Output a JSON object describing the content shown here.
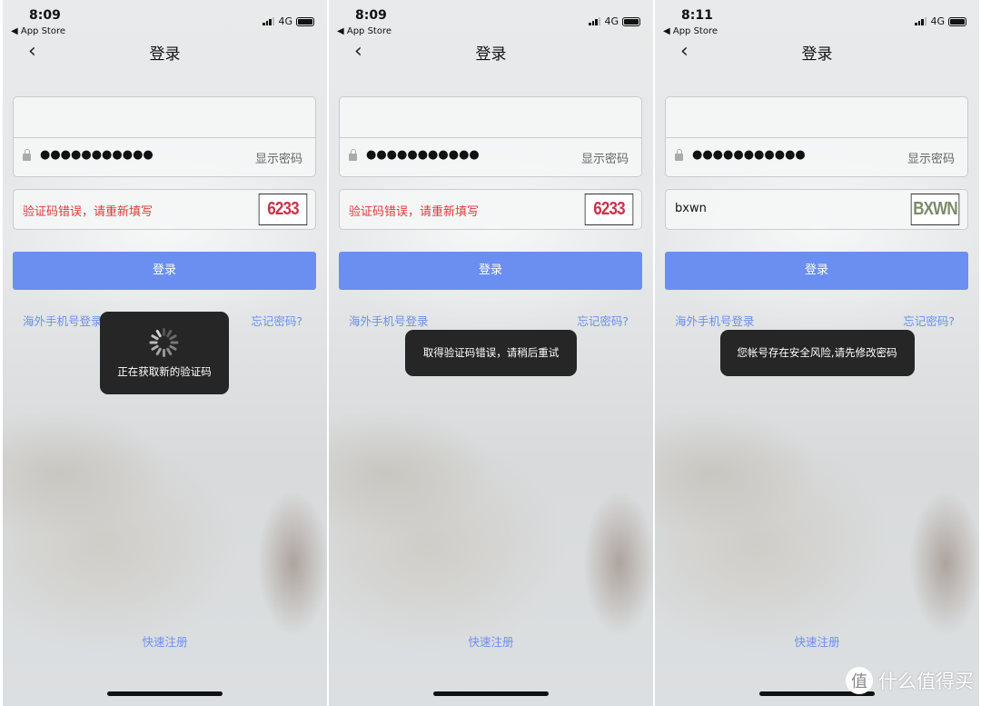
{
  "panels": [
    {
      "time": "8:09",
      "back_app": "◀ App Store",
      "network": "4G",
      "title": "登录",
      "password_mask": "●●●●●●●●●●●",
      "show_password": "显示密码",
      "captcha_value": "验证码错误，请重新填写",
      "captcha_error": true,
      "captcha_image_text": "6233",
      "captcha_color": "#c8334a",
      "login": "登录",
      "overseas": "海外手机号登录",
      "forgot": "忘记密码?",
      "toast": "正在获取新的验证码",
      "toast_loading": true,
      "register": "快速注册"
    },
    {
      "time": "8:09",
      "back_app": "◀ App Store",
      "network": "4G",
      "title": "登录",
      "password_mask": "●●●●●●●●●●●",
      "show_password": "显示密码",
      "captcha_value": "验证码错误，请重新填写",
      "captcha_error": true,
      "captcha_image_text": "6233",
      "captcha_color": "#c8334a",
      "login": "登录",
      "overseas": "海外手机号登录",
      "forgot": "忘记密码?",
      "toast": "取得验证码错误，请稍后重试",
      "toast_loading": false,
      "register": "快速注册"
    },
    {
      "time": "8:11",
      "back_app": "◀ App Store",
      "network": "4G",
      "title": "登录",
      "password_mask": "●●●●●●●●●●●",
      "show_password": "显示密码",
      "captcha_value": "bxwn",
      "captcha_error": false,
      "captcha_image_text": "BXWN",
      "captcha_color": "#7a8a6a",
      "login": "登录",
      "overseas": "海外手机号登录",
      "forgot": "忘记密码?",
      "toast": "您帐号存在安全风险,请先修改密码",
      "toast_loading": false,
      "register": "快速注册"
    }
  ],
  "colors": {
    "accent": "#6b8ff0",
    "error": "#e03a3a",
    "toast_bg": "#262626"
  },
  "watermark": {
    "logo": "值",
    "text": "什么值得买"
  }
}
